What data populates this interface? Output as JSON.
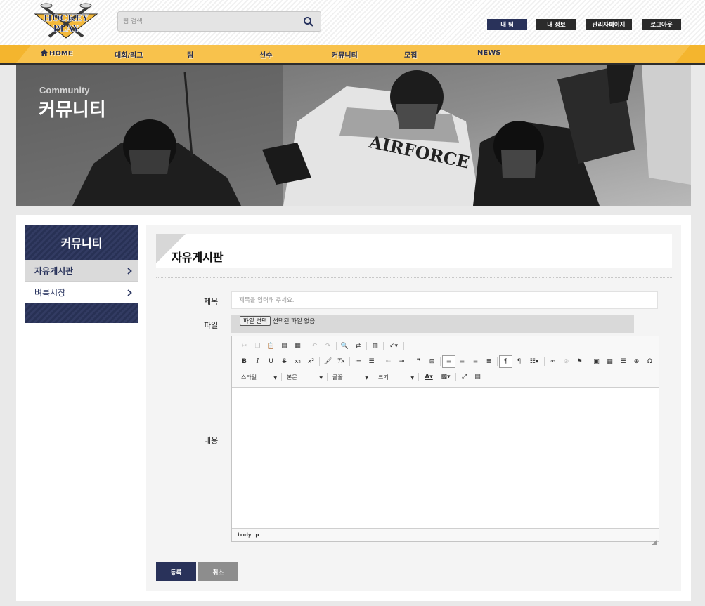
{
  "header": {
    "logo_text_top": "HOCKEY",
    "logo_text_bottom": "PLAY",
    "search_placeholder": "팀 검색",
    "user_buttons": [
      "내 팀",
      "내 정보",
      "관리자페이지",
      "로그아웃"
    ]
  },
  "nav": {
    "items": [
      "HOME",
      "대회/리그",
      "팀",
      "선수",
      "커뮤니티",
      "모집",
      "NEWS"
    ]
  },
  "hero": {
    "subtitle": "Community",
    "title": "커뮤니티"
  },
  "sidebar": {
    "title": "커뮤니티",
    "items": [
      {
        "label": "자유게시판",
        "active": true
      },
      {
        "label": "벼룩시장",
        "active": false
      }
    ]
  },
  "board": {
    "title": "자유게시판",
    "labels": {
      "subject": "제목",
      "file": "파일",
      "content": "내용"
    },
    "subject_placeholder": "제목을 입력해 주세요.",
    "file_button": "파일 선택",
    "file_status": "선택된 파일 없음",
    "editor": {
      "dropdowns": [
        "스타일",
        "본문",
        "글꼴",
        "크기"
      ],
      "path": [
        "body",
        "p"
      ]
    },
    "buttons": {
      "submit": "등록",
      "cancel": "취소"
    }
  },
  "colors": {
    "navy": "#29325a",
    "nav_yellow": "#f8c24c",
    "cancel_gray": "#8d8d8d"
  }
}
